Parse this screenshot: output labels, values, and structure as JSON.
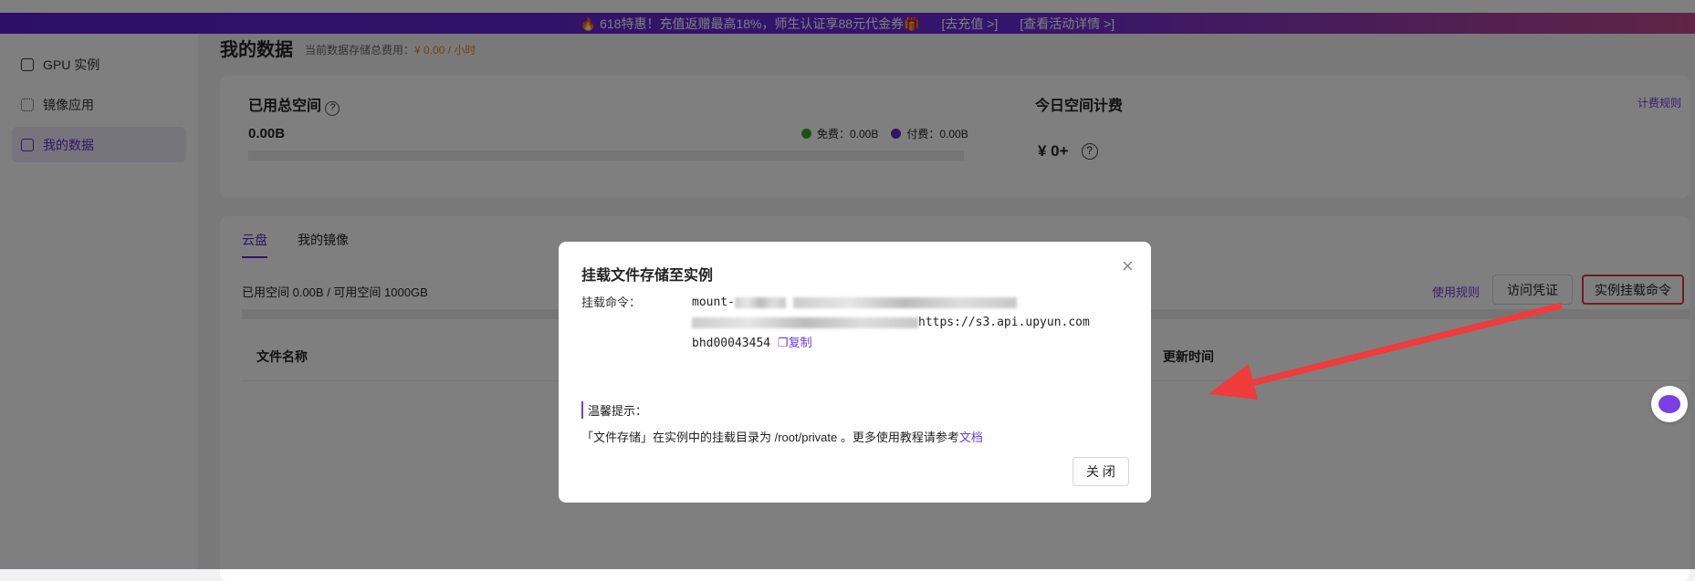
{
  "banner": {
    "text": "🔥 618特惠！充值返赠最高18%，师生认证享88元代金券🎁",
    "recharge": "[去充值 >]",
    "details": "[查看活动详情 >]"
  },
  "sidebar": {
    "items": [
      {
        "label": "GPU 实例"
      },
      {
        "label": "镜像应用"
      },
      {
        "label": "我的数据"
      }
    ]
  },
  "page": {
    "title": "我的数据",
    "cost_label": "当前数据存储总费用：",
    "cost_value": "¥ 0.00 / 小时"
  },
  "usage": {
    "title": "已用总空间",
    "value": "0.00B",
    "free_label": "免费：0.00B",
    "paid_label": "付费：0.00B",
    "free_color": "#3aa02a",
    "paid_color": "#5b2bd0",
    "used_fraction": 0
  },
  "billing": {
    "title": "今日空间计费",
    "rules_link": "计费规则",
    "amount": "¥ 0+"
  },
  "tabs": [
    {
      "label": "云盘",
      "active": true
    },
    {
      "label": "我的镜像",
      "active": false
    }
  ],
  "disk": {
    "summary": "已用空间 0.00B / 可用空间 1000GB",
    "usage_rules": "使用规则",
    "credentials": "访问凭证",
    "mount_cmd": "实例挂载命令",
    "used_fraction": 0
  },
  "table": {
    "columns": [
      "文件名称",
      "更新时间"
    ]
  },
  "modal": {
    "title": "挂载文件存储至实例",
    "cmd_label": "挂载命令：",
    "cmd_line1": "mount-",
    "cmd_line2_tail": "https://s3.api.upyun.com",
    "cmd_line3": "bhd00043454",
    "copy": "复制",
    "tip_title": "温馨提示：",
    "tip_text": "「文件存储」在实例中的挂载目录为 /root/private 。更多使用教程请参考",
    "tip_link": "文档",
    "close_button": "关 闭"
  }
}
